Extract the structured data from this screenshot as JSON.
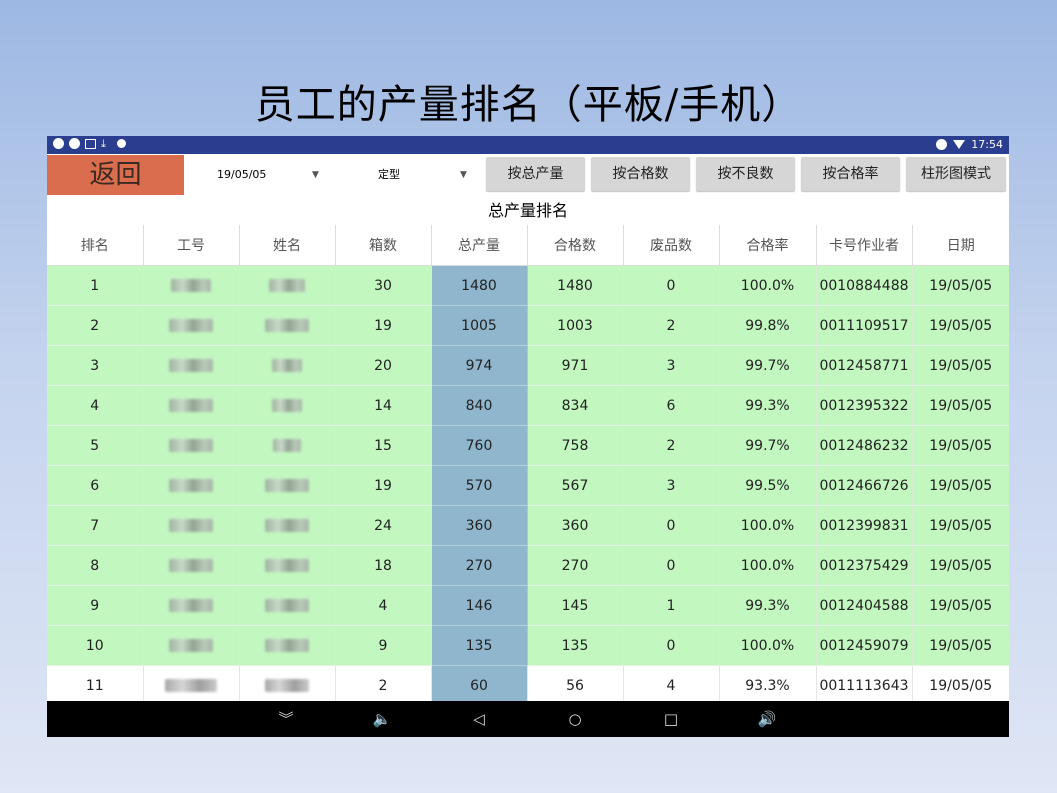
{
  "slide": {
    "title": "员工的产量排名（平板/手机）"
  },
  "statusbar": {
    "time": "17:54"
  },
  "toolbar": {
    "back_label": "返回",
    "date_value": "19/05/05",
    "type_value": "定型",
    "buttons": [
      "按总产量",
      "按合格数",
      "按不良数",
      "按合格率",
      "柱形图模式"
    ]
  },
  "table": {
    "title": "总产量排名",
    "headers": [
      "排名",
      "工号",
      "姓名",
      "箱数",
      "总产量",
      "合格数",
      "废品数",
      "合格率",
      "卡号作业者",
      "日期"
    ],
    "rows": [
      {
        "rank": "1",
        "boxes": "30",
        "total": "1480",
        "qualified": "1480",
        "defects": "0",
        "rate": "100.0%",
        "card": "0010884488",
        "date": "19/05/05"
      },
      {
        "rank": "2",
        "boxes": "19",
        "total": "1005",
        "qualified": "1003",
        "defects": "2",
        "rate": "99.8%",
        "card": "0011109517",
        "date": "19/05/05"
      },
      {
        "rank": "3",
        "boxes": "20",
        "total": "974",
        "qualified": "971",
        "defects": "3",
        "rate": "99.7%",
        "card": "0012458771",
        "date": "19/05/05"
      },
      {
        "rank": "4",
        "boxes": "14",
        "total": "840",
        "qualified": "834",
        "defects": "6",
        "rate": "99.3%",
        "card": "0012395322",
        "date": "19/05/05"
      },
      {
        "rank": "5",
        "boxes": "15",
        "total": "760",
        "qualified": "758",
        "defects": "2",
        "rate": "99.7%",
        "card": "0012486232",
        "date": "19/05/05"
      },
      {
        "rank": "6",
        "boxes": "19",
        "total": "570",
        "qualified": "567",
        "defects": "3",
        "rate": "99.5%",
        "card": "0012466726",
        "date": "19/05/05"
      },
      {
        "rank": "7",
        "boxes": "24",
        "total": "360",
        "qualified": "360",
        "defects": "0",
        "rate": "100.0%",
        "card": "0012399831",
        "date": "19/05/05"
      },
      {
        "rank": "8",
        "boxes": "18",
        "total": "270",
        "qualified": "270",
        "defects": "0",
        "rate": "100.0%",
        "card": "0012375429",
        "date": "19/05/05"
      },
      {
        "rank": "9",
        "boxes": "4",
        "total": "146",
        "qualified": "145",
        "defects": "1",
        "rate": "99.3%",
        "card": "0012404588",
        "date": "19/05/05"
      },
      {
        "rank": "10",
        "boxes": "9",
        "total": "135",
        "qualified": "135",
        "defects": "0",
        "rate": "100.0%",
        "card": "0012459079",
        "date": "19/05/05"
      },
      {
        "rank": "11",
        "boxes": "2",
        "total": "60",
        "qualified": "56",
        "defects": "4",
        "rate": "93.3%",
        "card": "0011113643",
        "date": "19/05/05"
      }
    ]
  },
  "colors": {
    "status_bar": "#2b3d8f",
    "back_button": "#d96d4e",
    "qualified_row": "#c2f7c0",
    "highlight_column": "#8fb6cd"
  },
  "icons": {
    "status_left": [
      "sync-icon",
      "sync-icon",
      "image-icon",
      "download-icon",
      "android-icon"
    ],
    "status_right": [
      "do-not-disturb-icon",
      "wifi-icon"
    ],
    "nav": [
      "collapse-icon",
      "volume-down-icon",
      "back-icon",
      "home-icon",
      "recents-icon",
      "volume-up-icon"
    ]
  }
}
